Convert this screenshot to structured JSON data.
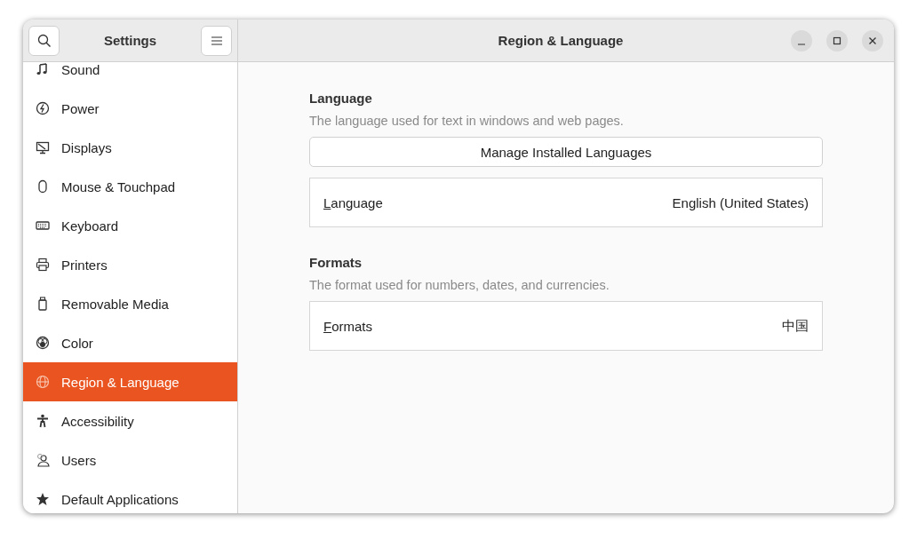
{
  "window": {
    "title": "Region & Language"
  },
  "sidebar": {
    "title": "Settings",
    "items": [
      {
        "label": "Sound",
        "selected": false
      },
      {
        "label": "Power",
        "selected": false
      },
      {
        "label": "Displays",
        "selected": false
      },
      {
        "label": "Mouse & Touchpad",
        "selected": false
      },
      {
        "label": "Keyboard",
        "selected": false
      },
      {
        "label": "Printers",
        "selected": false
      },
      {
        "label": "Removable Media",
        "selected": false
      },
      {
        "label": "Color",
        "selected": false
      },
      {
        "label": "Region & Language",
        "selected": true
      },
      {
        "label": "Accessibility",
        "selected": false
      },
      {
        "label": "Users",
        "selected": false
      },
      {
        "label": "Default Applications",
        "selected": false
      }
    ]
  },
  "sections": [
    {
      "title": "Language",
      "description": "The language used for text in windows and web pages.",
      "button": "Manage Installed Languages",
      "row": {
        "label": "Language",
        "value": "English (United States)",
        "mnemonic_underlined": true
      }
    },
    {
      "title": "Formats",
      "description": "The format used for numbers, dates, and currencies.",
      "row": {
        "label": "Formats",
        "value": "中国",
        "mnemonic_underlined": true
      }
    }
  ]
}
